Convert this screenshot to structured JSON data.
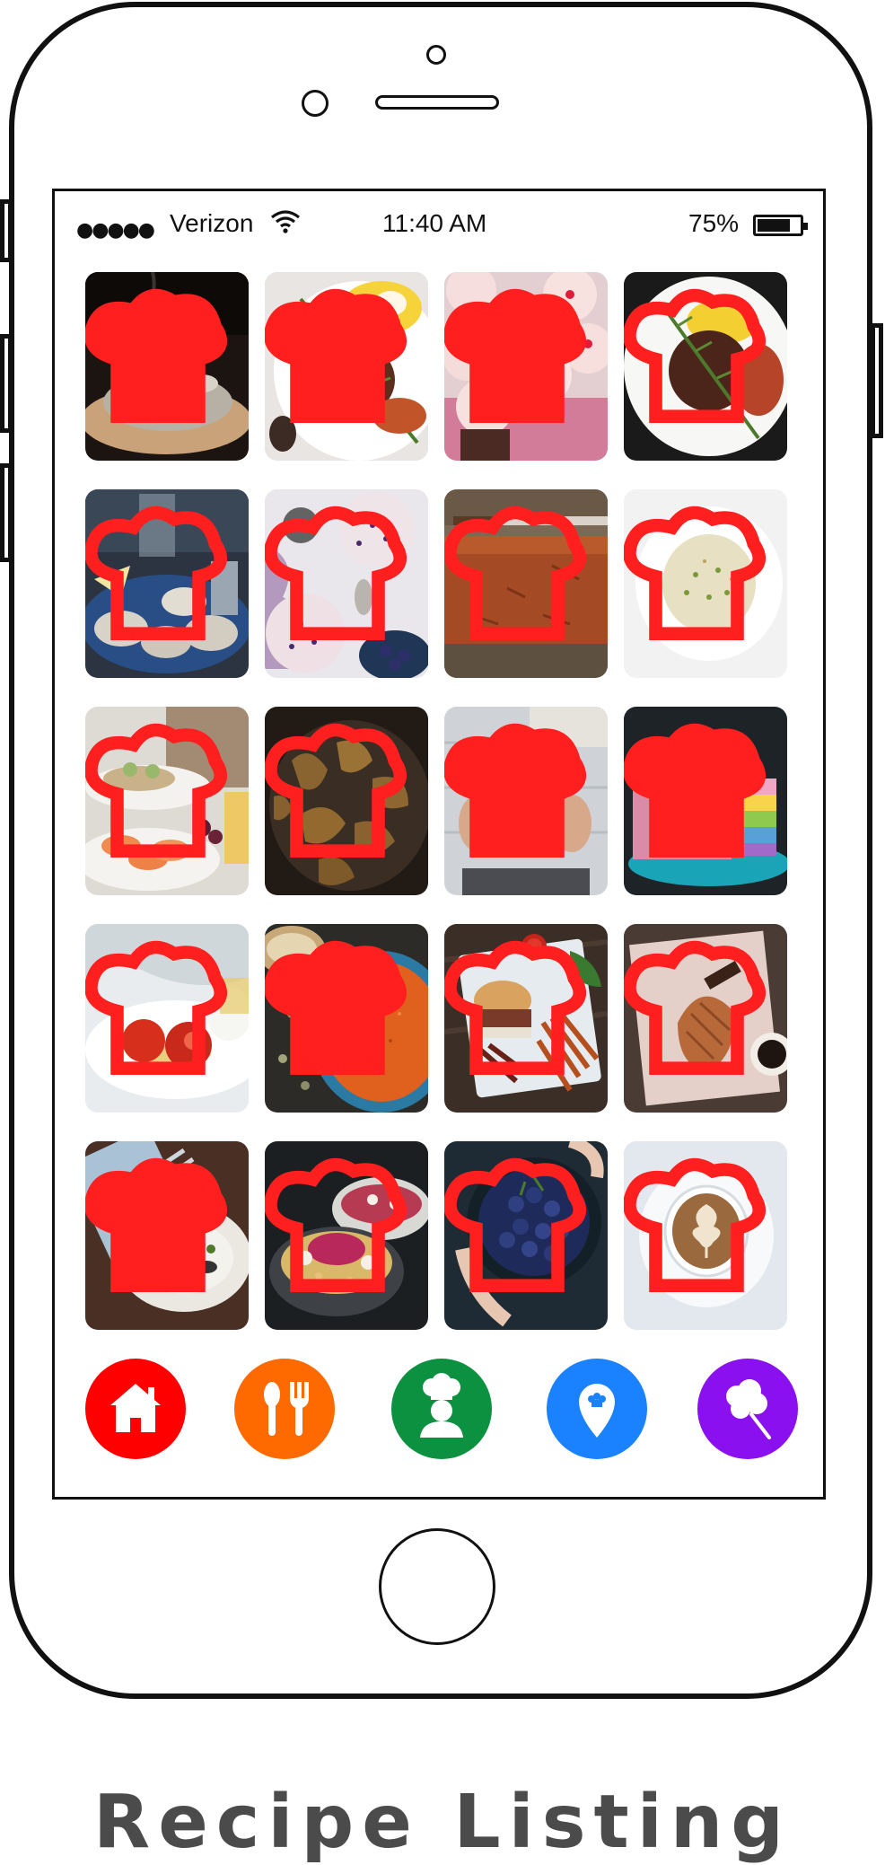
{
  "status_bar": {
    "signal": "●●●●●",
    "carrier": "Verizon",
    "time": "11:40 AM",
    "battery_percent": "75%"
  },
  "recipes": [
    {
      "icon": "poached-egg-toast",
      "fav_color": "#ff1f1f",
      "favorited": true
    },
    {
      "icon": "braised-beef-rosemary",
      "fav_color": "#ff1f1f",
      "favorited": true
    },
    {
      "icon": "pink-cupcakes",
      "fav_color": "#ff1f1f",
      "favorited": true
    },
    {
      "icon": "beef-plate-rosemary",
      "fav_color": "#ff1f1f",
      "favorited": false
    },
    {
      "icon": "oysters",
      "fav_color": "#ff1f1f",
      "favorited": false
    },
    {
      "icon": "blueberry-muffins",
      "fav_color": "#ff1f1f",
      "favorited": false
    },
    {
      "icon": "bread-loaf",
      "fav_color": "#ff1f1f",
      "favorited": false
    },
    {
      "icon": "risotto",
      "fav_color": "#ff1f1f",
      "favorited": false
    },
    {
      "icon": "shrimp-appetizers",
      "fav_color": "#ff1f1f",
      "favorited": false
    },
    {
      "icon": "fried-mushrooms",
      "fav_color": "#ff1f1f",
      "favorited": false
    },
    {
      "icon": "blue-plate-pastry",
      "fav_color": "#ff1f1f",
      "favorited": true
    },
    {
      "icon": "layer-cake",
      "fav_color": "#ff1f1f",
      "favorited": true
    },
    {
      "icon": "tomato-plate",
      "fav_color": "#ff1f1f",
      "favorited": false
    },
    {
      "icon": "couscous-bowl",
      "fav_color": "#ff1f1f",
      "favorited": true
    },
    {
      "icon": "burger-fries",
      "fav_color": "#ff1f1f",
      "favorited": false
    },
    {
      "icon": "croissant",
      "fav_color": "#ff1f1f",
      "favorited": false
    },
    {
      "icon": "roasted-vegetables",
      "fav_color": "#ff1f1f",
      "favorited": true
    },
    {
      "icon": "grain-bowls",
      "fav_color": "#ff1f1f",
      "favorited": false
    },
    {
      "icon": "blueberry-bowl",
      "fav_color": "#ff1f1f",
      "favorited": false
    },
    {
      "icon": "latte-art",
      "fav_color": "#ff1f1f",
      "favorited": false
    }
  ],
  "bottom_nav": [
    {
      "icon": "home-icon",
      "color": "#ff0000"
    },
    {
      "icon": "spoon-fork-icon",
      "color": "#ff6a00"
    },
    {
      "icon": "chef-icon",
      "color": "#0c9140"
    },
    {
      "icon": "location-pin-icon",
      "color": "#1a82ff"
    },
    {
      "icon": "cotton-candy-icon",
      "color": "#8b10f0"
    }
  ],
  "caption": "Recipe Listing"
}
